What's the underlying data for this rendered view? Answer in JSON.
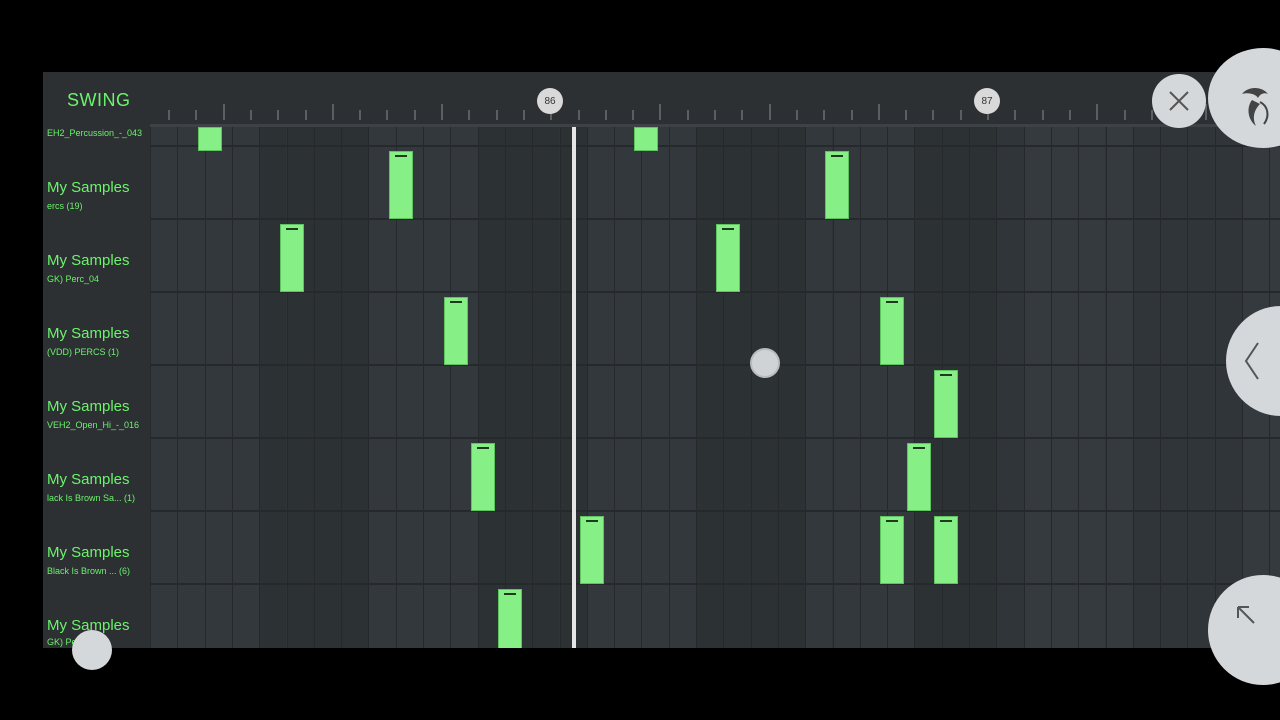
{
  "header": {
    "swing_label": "SWING",
    "bar_markers": [
      "86",
      "87"
    ]
  },
  "channels": [
    {
      "title": "",
      "subtitle": "EH2_Percussion_-_043"
    },
    {
      "title": "My Samples",
      "subtitle": "ercs (19)"
    },
    {
      "title": "My Samples",
      "subtitle": "GK) Perc_04"
    },
    {
      "title": "My Samples",
      "subtitle": "(VDD) PERCS (1)"
    },
    {
      "title": "My Samples",
      "subtitle": "VEH2_Open_Hi_-_016"
    },
    {
      "title": "My Samples",
      "subtitle": "lack Is Brown Sa... (1)"
    },
    {
      "title": "My Samples",
      "subtitle": "Black Is Brown ... (6)"
    },
    {
      "title": "My Samples",
      "subtitle": "GK) Pe"
    }
  ],
  "colors": {
    "note": "#86ef86",
    "label": "#6cf36c",
    "grid_bg": "#2f3437",
    "playhead": "#e5e5e5"
  },
  "icons": {
    "close": "close-icon",
    "logo": "fl-studio-logo-icon",
    "back": "chevron-left-icon",
    "expand": "arrow-up-left-icon"
  }
}
